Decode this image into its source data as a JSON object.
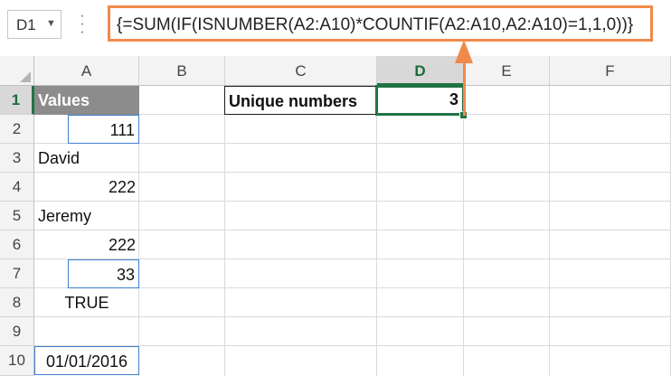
{
  "name_box": {
    "value": "D1",
    "dropdown_icon": "triangle-down-icon"
  },
  "formula_bar": {
    "menu_icon": "vertical-dots-icon",
    "formula": "{=SUM(IF(ISNUMBER(A2:A10)*COUNTIF(A2:A10,A2:A10)=1,1,0))}"
  },
  "columns": [
    "A",
    "B",
    "C",
    "D",
    "E",
    "F"
  ],
  "rows": [
    "1",
    "2",
    "3",
    "4",
    "5",
    "6",
    "7",
    "8",
    "9",
    "10"
  ],
  "selected_cell": "D1",
  "cells": {
    "A1": "Values",
    "A2": "111",
    "A3": "David",
    "A4": "222",
    "A5": "Jeremy",
    "A6": "222",
    "A7": "33",
    "A8": "TRUE",
    "A10": "01/01/2016",
    "C1": "Unique numbers",
    "D1": "3"
  },
  "colors": {
    "formula_highlight": "#f0894a",
    "selection": "#217346",
    "unique_cell_border": "#3f7fd0",
    "header_fill": "#8c8c8c"
  }
}
